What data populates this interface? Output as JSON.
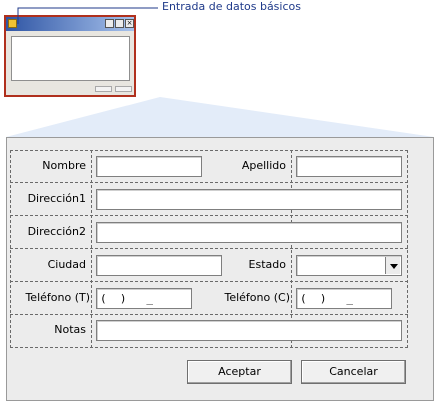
{
  "callout": {
    "label": "Entrada de datos básicos"
  },
  "form": {
    "nombre_label": "Nombre",
    "apellido_label": "Apellido",
    "direccion1_label": "Dirección1",
    "direccion2_label": "Dirección2",
    "ciudad_label": "Ciudad",
    "estado_label": "Estado",
    "telefono_t_label": "Teléfono (T)",
    "telefono_c_label": "Teléfono (C)",
    "telefono_mask": "(  )   _   ",
    "notas_label": "Notas"
  },
  "buttons": {
    "accept": "Aceptar",
    "cancel": "Cancelar"
  }
}
